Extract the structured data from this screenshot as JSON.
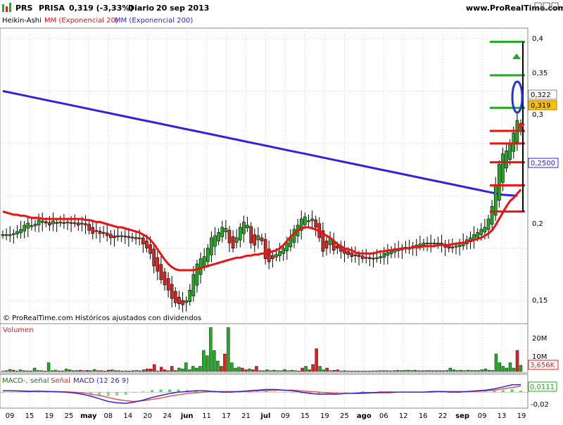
{
  "header": {
    "symbol": "PRS",
    "name": "PRISA",
    "quote": "0,319 (-3,33%)",
    "period": "Diario",
    "date": "20 sep 2013",
    "site": "www.ProRealTime.com"
  },
  "indicators_line": {
    "heikin": "Heikin-Ashi",
    "ema20": "MM (Exponencial 20)",
    "ema200": "MM (Exponencial 200)"
  },
  "copyright": "© ProRealTime.com Históricos ajustados con dividendos",
  "volume_label": "Volumen",
  "macd_label": {
    "a": "MACD-, señal",
    "b": "Señal",
    "c": "MACD (12 26 9)"
  },
  "colors": {
    "up": "#22aa22",
    "down": "#dd2222",
    "ema20": "#ee1111",
    "ema200": "#3322dd",
    "grid": "#cccccc",
    "last_price_bg": "#ffc000"
  },
  "price_axis": {
    "ticks": [
      "0,4",
      "0,35",
      "0,3",
      "0,2",
      "0,15"
    ]
  },
  "tags": {
    "t322": "0,322",
    "t319": "0,319",
    "t2500": "0,2500"
  },
  "volume_axis": {
    "ticks": [
      "20M",
      "10M"
    ],
    "last": "3,656K"
  },
  "macd_axis": {
    "tag1": "0,0111",
    "t_neg": "-0,02"
  },
  "x_axis_labels": [
    "09",
    "15",
    "19",
    "25",
    "may",
    "08",
    "14",
    "20",
    "24",
    "jun",
    "11",
    "17",
    "21",
    "jul",
    "09",
    "15",
    "19",
    "25",
    "ago",
    "06",
    "12",
    "16",
    "22",
    "sep",
    "09",
    "13",
    "19"
  ],
  "chart_data": [
    {
      "type": "candlestick",
      "title": "PRS - PRISA",
      "ylim": [
        0.128,
        0.41
      ],
      "ha_close": [
        0.213,
        0.213,
        0.213,
        0.214,
        0.216,
        0.218,
        0.222,
        0.224,
        0.221,
        0.223,
        0.227,
        0.226,
        0.224,
        0.222,
        0.226,
        0.224,
        0.225,
        0.224,
        0.225,
        0.224,
        0.224,
        0.222,
        0.224,
        0.222,
        0.217,
        0.214,
        0.216,
        0.214,
        0.214,
        0.212,
        0.21,
        0.21,
        0.212,
        0.212,
        0.211,
        0.21,
        0.21,
        0.209,
        0.21,
        0.204,
        0.2,
        0.195,
        0.183,
        0.178,
        0.17,
        0.165,
        0.16,
        0.152,
        0.148,
        0.147,
        0.146,
        0.15,
        0.16,
        0.175,
        0.185,
        0.19,
        0.192,
        0.2,
        0.21,
        0.212,
        0.215,
        0.22,
        0.219,
        0.205,
        0.2,
        0.21,
        0.22,
        0.225,
        0.222,
        0.205,
        0.203,
        0.212,
        0.207,
        0.19,
        0.187,
        0.19,
        0.194,
        0.197,
        0.2,
        0.205,
        0.21,
        0.218,
        0.222,
        0.228,
        0.23,
        0.226,
        0.228,
        0.22,
        0.21,
        0.197,
        0.2,
        0.21,
        0.198,
        0.2,
        0.197,
        0.195,
        0.194,
        0.192,
        0.193,
        0.192,
        0.19,
        0.191,
        0.19,
        0.19,
        0.191,
        0.192,
        0.195,
        0.196,
        0.198,
        0.199,
        0.199,
        0.2,
        0.201,
        0.2,
        0.202,
        0.203,
        0.204,
        0.205,
        0.205,
        0.205,
        0.205,
        0.205,
        0.203,
        0.201,
        0.2,
        0.201,
        0.202,
        0.203,
        0.206,
        0.208,
        0.21,
        0.213,
        0.215,
        0.218,
        0.22,
        0.228,
        0.24,
        0.26,
        0.28,
        0.29,
        0.293,
        0.3,
        0.31,
        0.322,
        0.319
      ],
      "ema20": [
        0.235,
        0.234,
        0.233,
        0.232,
        0.232,
        0.231,
        0.231,
        0.23,
        0.229,
        0.229,
        0.229,
        0.228,
        0.228,
        0.228,
        0.228,
        0.228,
        0.228,
        0.228,
        0.228,
        0.228,
        0.228,
        0.228,
        0.228,
        0.227,
        0.227,
        0.226,
        0.225,
        0.225,
        0.224,
        0.223,
        0.222,
        0.221,
        0.22,
        0.22,
        0.219,
        0.218,
        0.217,
        0.216,
        0.215,
        0.213,
        0.211,
        0.208,
        0.204,
        0.199,
        0.194,
        0.189,
        0.185,
        0.182,
        0.18,
        0.179,
        0.179,
        0.179,
        0.179,
        0.179,
        0.18,
        0.181,
        0.182,
        0.183,
        0.184,
        0.185,
        0.186,
        0.187,
        0.188,
        0.189,
        0.19,
        0.191,
        0.191,
        0.192,
        0.193,
        0.193,
        0.194,
        0.194,
        0.195,
        0.195,
        0.196,
        0.197,
        0.198,
        0.2,
        0.203,
        0.207,
        0.211,
        0.214,
        0.217,
        0.219,
        0.22,
        0.22,
        0.219,
        0.218,
        0.216,
        0.214,
        0.212,
        0.21,
        0.207,
        0.204,
        0.202,
        0.2,
        0.199,
        0.198,
        0.196,
        0.195,
        0.195,
        0.195,
        0.195,
        0.195,
        0.196,
        0.197,
        0.197,
        0.198,
        0.198,
        0.199,
        0.199,
        0.2,
        0.2,
        0.2,
        0.201,
        0.201,
        0.201,
        0.202,
        0.202,
        0.202,
        0.202,
        0.203,
        0.203,
        0.203,
        0.203,
        0.204,
        0.204,
        0.205,
        0.205,
        0.206,
        0.207,
        0.208,
        0.209,
        0.21,
        0.212,
        0.214,
        0.217,
        0.222,
        0.228,
        0.234,
        0.24,
        0.245,
        0.248,
        0.252,
        0.256
      ],
      "ema200": [
        0.35,
        0.347,
        0.344,
        0.341,
        0.338,
        0.335,
        0.332,
        0.329,
        0.326,
        0.323,
        0.32,
        0.317,
        0.314,
        0.311,
        0.308,
        0.305,
        0.302,
        0.299,
        0.296,
        0.293,
        0.29,
        0.287,
        0.284,
        0.281,
        0.278,
        0.275,
        0.272,
        0.269,
        0.266,
        0.263,
        0.26,
        0.257,
        0.254,
        0.251,
        0.25
      ],
      "resistance_levels": [
        0.397,
        0.365,
        0.334,
        0.312,
        0.3,
        0.282,
        0.26,
        0.235
      ]
    },
    {
      "type": "bar",
      "title": "Volumen",
      "ylim": [
        0,
        24
      ],
      "values": [
        0.2,
        0.5,
        1.2,
        0.8,
        0.3,
        1.0,
        0.5,
        0.4,
        0.4,
        2.0,
        0.6,
        0.5,
        0.3,
        5.0,
        0.5,
        0.8,
        0.4,
        0.4,
        1.5,
        1.0,
        0.5,
        0.6,
        0.8,
        0.5,
        0.7,
        0.5,
        1.2,
        0.5,
        0.5,
        0.3,
        0.8,
        1.0,
        0.5,
        0.5,
        0.3,
        0.4,
        0.3,
        0.5,
        0.6,
        0.4,
        1.0,
        1.5,
        1.5,
        4.0,
        0.3,
        2.5,
        1.0,
        0.5,
        3.0,
        0.6,
        2.0,
        1.5,
        5.0,
        1.0,
        3.0,
        2.0,
        3.0,
        12.0,
        9.0,
        25.0,
        12.0,
        6.0,
        3.0,
        10.0,
        25.0,
        5.0,
        2.0,
        2.5,
        2.0,
        1.0,
        1.5,
        1.0,
        3.0,
        0.5,
        0.5,
        1.0,
        0.5,
        0.8,
        0.5,
        0.5,
        1.2,
        0.5,
        0.8,
        0.5,
        0.3,
        2.0,
        3.0,
        1.0,
        4.0,
        13.0,
        3.0,
        1.0,
        2.0,
        0.5,
        0.7,
        1.0,
        0.3,
        0.5,
        0.3,
        0.3,
        0.3,
        0.3,
        0.3,
        0.3,
        0.3,
        0.4,
        0.4,
        0.5,
        0.5,
        0.5,
        0.4,
        0.5,
        0.7,
        0.5,
        0.6,
        0.8,
        0.6,
        0.8,
        0.5,
        0.5,
        0.5,
        0.6,
        0.5,
        0.5,
        0.5,
        0.5,
        0.6,
        2.0,
        1.0,
        0.6,
        0.8,
        0.5,
        0.8,
        0.6,
        0.6,
        0.6,
        1.0,
        1.5,
        0.8,
        0.6,
        10.0,
        5.0,
        3.0,
        2.0,
        5.0,
        2.0,
        12.0,
        3.6
      ],
      "down_flags": [
        0,
        0,
        0,
        1,
        1,
        0,
        1,
        0,
        0,
        0,
        0,
        0,
        1,
        0,
        1,
        0,
        1,
        1,
        0,
        0,
        1,
        0,
        1,
        0,
        1,
        1,
        0,
        1,
        1,
        1,
        1,
        0,
        1,
        1,
        1,
        0,
        1,
        1,
        0,
        1,
        1,
        1,
        1,
        1,
        1,
        1,
        1,
        1,
        1,
        1,
        0,
        0,
        0,
        0,
        0,
        0,
        0,
        0,
        0,
        0,
        0,
        0,
        1,
        1,
        0,
        0,
        0,
        0,
        1,
        1,
        0,
        1,
        1,
        1,
        0,
        0,
        0,
        0,
        0,
        0,
        0,
        0,
        0,
        0,
        0,
        1,
        0,
        1,
        1,
        1,
        0,
        0,
        1,
        0,
        1,
        1,
        0,
        1,
        0,
        1,
        1,
        0,
        1,
        0,
        0,
        0,
        0,
        0,
        0,
        0,
        0,
        0,
        0,
        1,
        0,
        0,
        0,
        0,
        0,
        0,
        0,
        0,
        1,
        1,
        1,
        0,
        0,
        0,
        0,
        0,
        0,
        0,
        0,
        0,
        0,
        0,
        0,
        0,
        0,
        0,
        0,
        0,
        0,
        0,
        0,
        0,
        1,
        0
      ]
    },
    {
      "type": "line",
      "title": "MACD (12 26 9)",
      "ylim": [
        -0.022,
        0.012
      ],
      "macd": [
        0.002,
        0.002,
        0.0015,
        0.001,
        0.0015,
        0.001,
        0.0005,
        0.0,
        -0.001,
        -0.003,
        -0.006,
        -0.01,
        -0.014,
        -0.016,
        -0.017,
        -0.015,
        -0.012,
        -0.008,
        -0.005,
        -0.002,
        0.0,
        0.001,
        0.002,
        0.002,
        0.001,
        0.0,
        0.0,
        0.001,
        0.002,
        0.003,
        0.004,
        0.004,
        0.003,
        0.002,
        0.0,
        -0.002,
        -0.003,
        -0.003,
        -0.003,
        -0.002,
        -0.002,
        -0.001,
        -0.001,
        0.0,
        0.0,
        0.0,
        0.0,
        0.0,
        0.0,
        0.001,
        0.001,
        0.0,
        0.0,
        0.001,
        0.002,
        0.003,
        0.005,
        0.008,
        0.011,
        0.0111
      ],
      "signal": [
        0.002,
        0.002,
        0.002,
        0.0015,
        0.0015,
        0.0012,
        0.001,
        0.0005,
        0.0,
        -0.001,
        -0.003,
        -0.005,
        -0.008,
        -0.011,
        -0.013,
        -0.014,
        -0.013,
        -0.011,
        -0.009,
        -0.006,
        -0.004,
        -0.002,
        -0.001,
        0.0,
        0.001,
        0.001,
        0.001,
        0.001,
        0.001,
        0.002,
        0.002,
        0.003,
        0.003,
        0.003,
        0.002,
        0.001,
        0.0,
        -0.001,
        -0.002,
        -0.002,
        -0.002,
        -0.002,
        -0.001,
        -0.001,
        -0.001,
        0.0,
        0.0,
        0.0,
        0.0,
        0.0,
        0.001,
        0.001,
        0.001,
        0.001,
        0.001,
        0.002,
        0.003,
        0.005,
        0.007,
        0.009
      ]
    }
  ]
}
